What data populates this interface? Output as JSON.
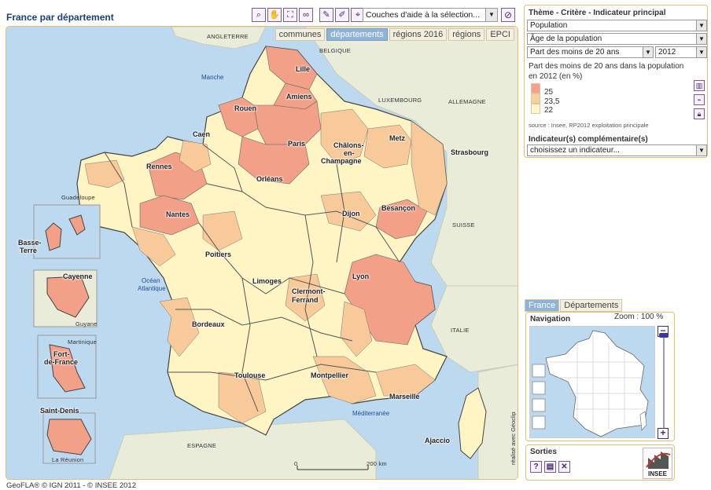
{
  "title": "France par département",
  "toolbar": {
    "tools": [
      "zoom-icon",
      "pan-hand-icon",
      "fullscreen-icon",
      "binoculars-icon",
      "measure-icon",
      "measure-area-icon",
      "pin-icon"
    ],
    "layer_select": "Couches d'aide à la sélection...",
    "clear_tool": "erase-selection-icon"
  },
  "tabs": [
    "communes",
    "départements",
    "régions 2016",
    "régions",
    "EPCI"
  ],
  "active_tab": "départements",
  "sea": {
    "manche": "Manche",
    "ocean1": "Océan",
    "ocean2": "Atlantique",
    "med": "Méditerranée"
  },
  "countries": {
    "angleterre": "ANGLETERRE",
    "belgique": "BELGIQUE",
    "luxembourg": "LUXEMBOURG",
    "allemagne": "ALLEMAGNE",
    "suisse": "SUISSE",
    "italie": "ITALIE",
    "espagne": "ESPAGNE"
  },
  "dom": {
    "guadeloupe": "Guadeloupe",
    "guyane": "Guyane",
    "martinique": "Martinique",
    "reunion": "La Réunion"
  },
  "cities": {
    "lille": "Lille",
    "amiens": "Amiens",
    "rouen": "Rouen",
    "caen": "Caen",
    "paris": "Paris",
    "chalons1": "Châlons-",
    "chalons2": "en-",
    "chalons3": "Champagne",
    "metz": "Metz",
    "strasbourg": "Strasbourg",
    "rennes": "Rennes",
    "orleans": "Orléans",
    "nantes": "Nantes",
    "dijon": "Dijon",
    "besancon": "Besançon",
    "poitiers": "Poitiers",
    "limoges": "Limoges",
    "clermont1": "Clermont-",
    "clermont2": "Ferrand",
    "lyon": "Lyon",
    "bordeaux": "Bordeaux",
    "toulouse": "Toulouse",
    "montpellier": "Montpellier",
    "marseille": "Marseille",
    "ajaccio": "Ajaccio",
    "basse1": "Basse-",
    "basse2": "Terre",
    "cayenne": "Cayenne",
    "fort1": "Fort-",
    "fort2": "de-France",
    "stdenis": "Saint-Denis"
  },
  "scale": {
    "zero": "0",
    "km": "200 km"
  },
  "credit": "réalisé avec Géoclip",
  "footer": "GéoFLA® © IGN 2011  -  © INSEE 2012",
  "panel": {
    "heading": "Thème - Critère - Indicateur principal",
    "theme": "Population",
    "critere": "Âge de la population",
    "indicateur": "Part des moins de 20 ans",
    "annee": "2012",
    "indic_title": "Part des moins de 20 ans dans la population en 2012 (en %)",
    "legend": [
      {
        "value": "25",
        "color": "#f5a08a"
      },
      {
        "value": "23,5",
        "color": "#f9cf9b"
      },
      {
        "value": "22",
        "color": "#fff6c9"
      }
    ],
    "source": "source : Insee, RP2012 exploitation principale",
    "comp_label": "Indicateur(s) complémentaire(s)",
    "comp_select": "choisissez un indicateur..."
  },
  "nav": {
    "tabs": [
      "France",
      "Départements"
    ],
    "label": "Navigation",
    "zoom": "Zoom : 100 %"
  },
  "sorties": {
    "label": "Sorties",
    "buttons": [
      "help-icon",
      "print-icon",
      "close-icon"
    ]
  },
  "logo": "INSEE"
}
